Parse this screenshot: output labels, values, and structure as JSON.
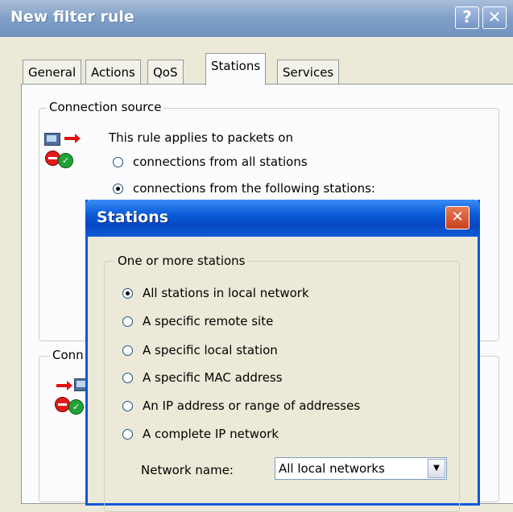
{
  "window": {
    "title": "New filter rule",
    "help_glyph": "?",
    "close_glyph": "✕"
  },
  "tabs": [
    {
      "label": "General",
      "selected": false
    },
    {
      "label": "Actions",
      "selected": false
    },
    {
      "label": "QoS",
      "selected": false
    },
    {
      "label": "Stations",
      "selected": true
    },
    {
      "label": "Services",
      "selected": false
    }
  ],
  "connection_source": {
    "legend": "Connection source",
    "intro": "This rule applies to packets on",
    "options": [
      {
        "label": "connections from all stations",
        "selected": false
      },
      {
        "label": "connections from the following stations:",
        "selected": true
      }
    ]
  },
  "connection_dest": {
    "legend_partial": "Conn"
  },
  "stations_dialog": {
    "title": "Stations",
    "close_glyph": "✕",
    "group_legend": "One or more stations",
    "options": [
      {
        "label": "All stations in local network",
        "selected": true
      },
      {
        "label": "A specific remote site",
        "selected": false
      },
      {
        "label": "A specific local station",
        "selected": false
      },
      {
        "label": "A specific MAC address",
        "selected": false
      },
      {
        "label": "An IP address or range of addresses",
        "selected": false
      },
      {
        "label": "A complete IP network",
        "selected": false
      }
    ],
    "network_name_label": "Network name:",
    "network_name_value": "All local networks",
    "dropdown_glyph": "▼"
  },
  "colors": {
    "outer_title": "#7f9fc6",
    "inner_title": "#0a5bd8",
    "radio_dot": "#21a121"
  }
}
